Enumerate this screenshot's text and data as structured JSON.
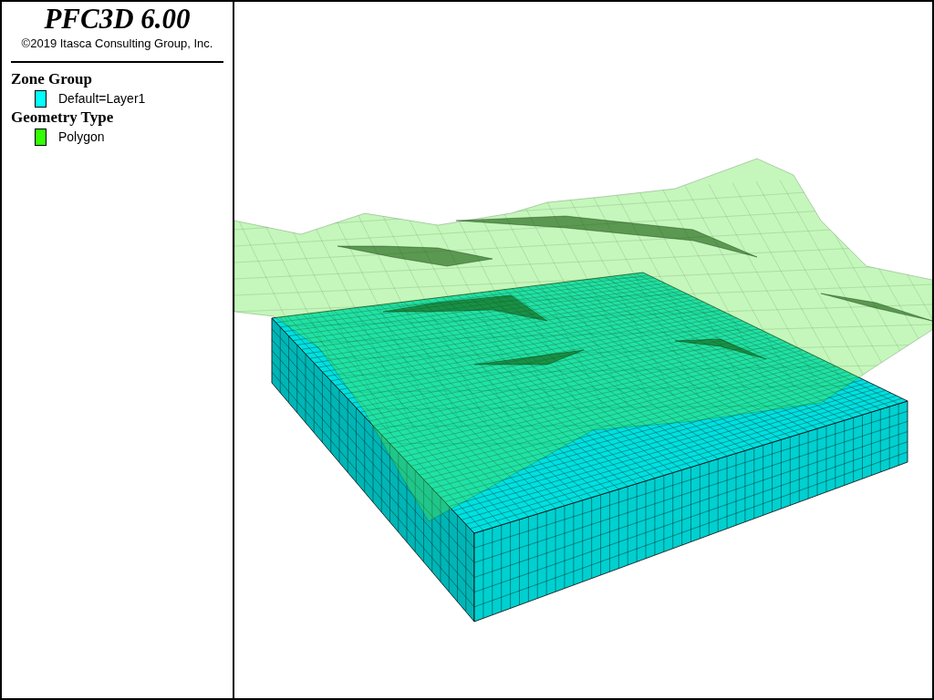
{
  "title": "PFC3D 6.00",
  "copyright": "©2019 Itasca Consulting Group, Inc.",
  "legend": [
    {
      "heading": "Zone Group",
      "items": [
        {
          "label": "Default=Layer1",
          "color": "#00ffff"
        }
      ]
    },
    {
      "heading": "Geometry Type",
      "items": [
        {
          "label": "Polygon",
          "color": "#33ff00"
        }
      ]
    }
  ]
}
